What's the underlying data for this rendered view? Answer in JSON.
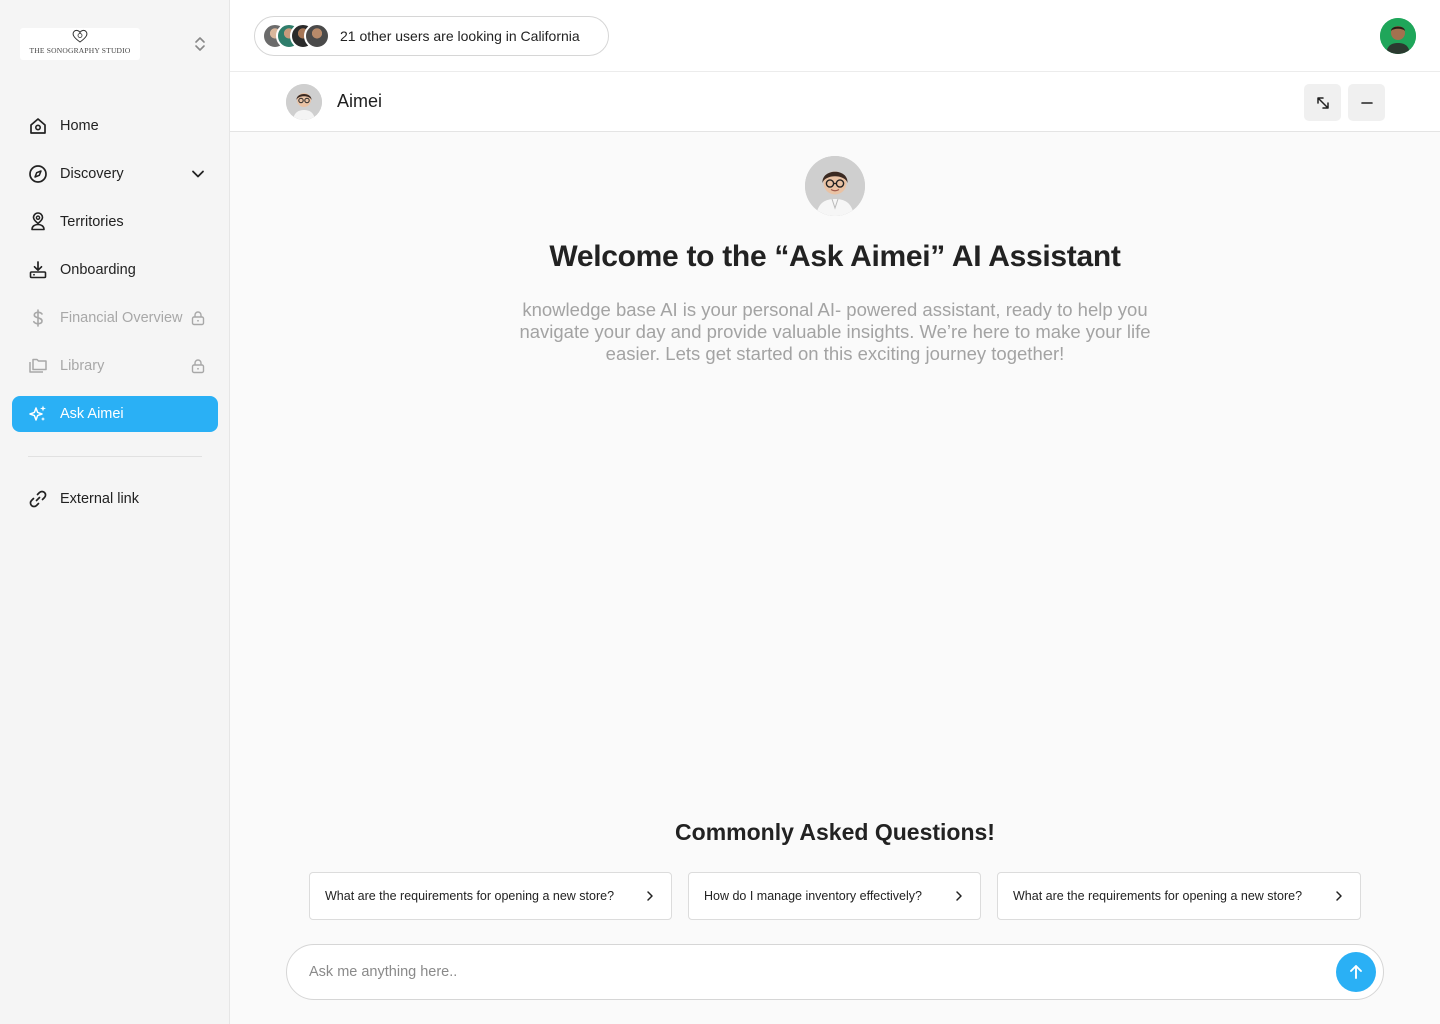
{
  "brand": {
    "name": "THE SONOGRAPHY STUDIO",
    "logo_icon": "heart-logo-icon"
  },
  "sidebar": {
    "items": [
      {
        "label": "Home",
        "icon": "home-icon"
      },
      {
        "label": "Discovery",
        "icon": "compass-icon",
        "trailing": "chevron-down-icon"
      },
      {
        "label": "Territories",
        "icon": "map-pin-user-icon"
      },
      {
        "label": "Onboarding",
        "icon": "download-tray-icon"
      },
      {
        "label": "Financial Overview",
        "icon": "dollar-icon",
        "trailing": "lock-icon",
        "disabled": true
      },
      {
        "label": "Library",
        "icon": "folders-icon",
        "trailing": "lock-icon",
        "disabled": true
      },
      {
        "label": "Ask Aimei",
        "icon": "sparkles-icon",
        "active": true
      }
    ],
    "external": {
      "label": "External link",
      "icon": "link-icon"
    }
  },
  "topbar": {
    "presence_text": "21 other users are  looking in California"
  },
  "chat": {
    "bot_name": "Aimei",
    "welcome": "Welcome to the “Ask Aimei” AI Assistant",
    "intro": "knowledge base AI is your personal AI- powered assistant, ready to help you navigate your day and provide valuable insights. We’re here to make your life easier. Lets get started on this exciting journey together!",
    "faq_title": "Commonly Asked Questions!",
    "faqs": [
      "What are the requirements for opening a new store?",
      "How do I manage inventory effectively?",
      "What are the requirements for opening a new store?"
    ],
    "input_placeholder": "Ask me anything here..",
    "input_value": ""
  },
  "colors": {
    "accent": "#2ab0f5",
    "sidebar_bg": "#f5f5f5",
    "main_bg": "#fafafa"
  }
}
